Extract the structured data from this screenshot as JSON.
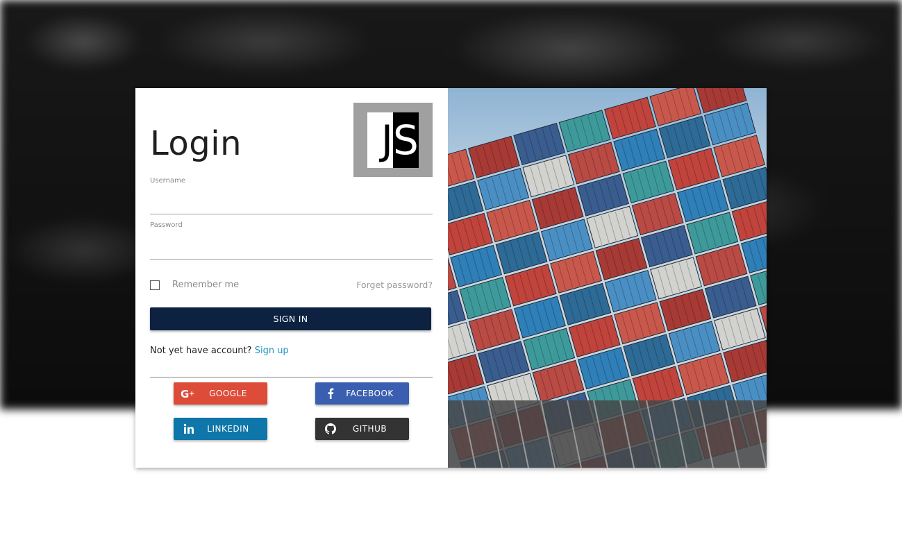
{
  "form": {
    "title": "Login",
    "logo_text": "JS",
    "username_label": "Username",
    "username_value": "",
    "password_label": "Password",
    "password_value": "",
    "remember_label": "Remember me",
    "forgot_label": "Forget password?",
    "signin_label": "SIGN IN",
    "no_account_text": "Not yet have account?",
    "signup_label": "Sign up"
  },
  "social": {
    "google": {
      "label": "GOOGLE",
      "icon": "google-plus-icon",
      "color": "#dd4b39"
    },
    "facebook": {
      "label": "FACEBOOK",
      "icon": "facebook-icon",
      "color": "#3b5fb0"
    },
    "linkedin": {
      "label": "LINKEDIN",
      "icon": "linkedin-icon",
      "color": "#0e76a8"
    },
    "github": {
      "label": "GITHUB",
      "icon": "github-icon",
      "color": "#333333"
    }
  },
  "colors": {
    "primary_button": "#0d2240",
    "link": "#2196c4"
  }
}
